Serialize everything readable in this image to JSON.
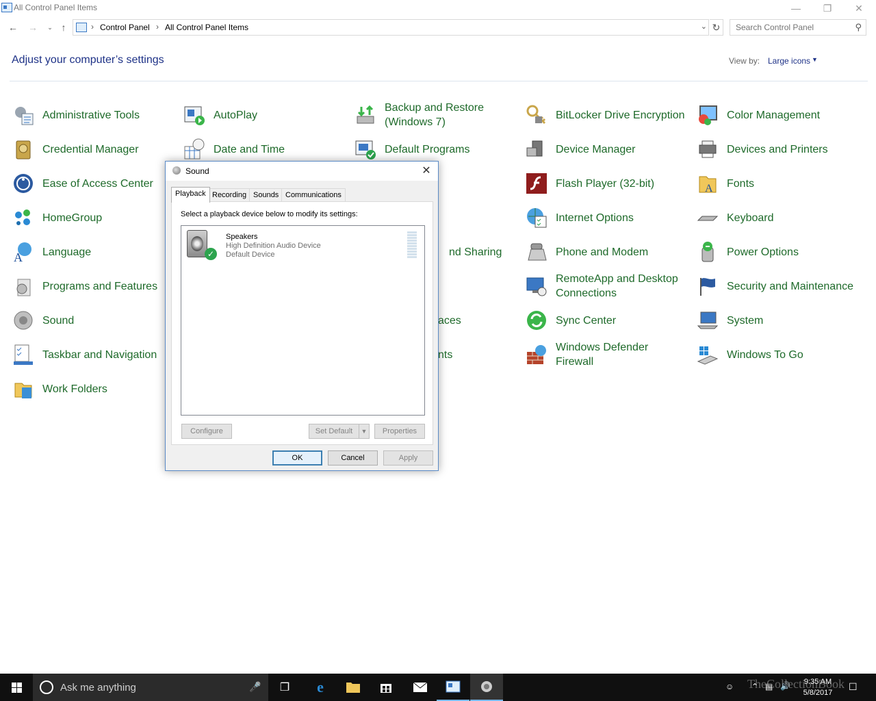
{
  "window": {
    "title": "All Control Panel Items"
  },
  "address": {
    "crumbs": [
      "Control Panel",
      "All Control Panel Items"
    ],
    "search_placeholder": "Search Control Panel"
  },
  "header": {
    "heading": "Adjust your computer’s settings",
    "view_by_label": "View by:",
    "view_by_value": "Large icons"
  },
  "items": [
    {
      "label": "Administrative Tools",
      "icon": "admin-tools-icon"
    },
    {
      "label": "AutoPlay",
      "icon": "autoplay-icon"
    },
    {
      "label": "Backup and Restore (Windows 7)",
      "line1": "Backup and Restore",
      "line2": "(Windows 7)",
      "icon": "backup-icon"
    },
    {
      "label": "BitLocker Drive Encryption",
      "icon": "bitlocker-icon"
    },
    {
      "label": "Color Management",
      "icon": "color-management-icon"
    },
    {
      "label": "Credential Manager",
      "icon": "credential-manager-icon"
    },
    {
      "label": "Date and Time",
      "icon": "date-time-icon"
    },
    {
      "label": "Default Programs",
      "icon": "default-programs-icon"
    },
    {
      "label": "Device Manager",
      "icon": "device-manager-icon"
    },
    {
      "label": "Devices and Printers",
      "icon": "devices-printers-icon"
    },
    {
      "label": "Ease of Access Center",
      "icon": "ease-of-access-icon"
    },
    {
      "label": "Flash Player (32-bit)",
      "icon": "flash-player-icon"
    },
    {
      "label": "Fonts",
      "icon": "fonts-icon"
    },
    {
      "label": "HomeGroup",
      "icon": "homegroup-icon"
    },
    {
      "label": "nd Sharing",
      "icon": ""
    },
    {
      "label": "Internet Options",
      "icon": "internet-options-icon"
    },
    {
      "label": "Keyboard",
      "icon": "keyboard-icon"
    },
    {
      "label": "Language",
      "icon": "language-icon"
    },
    {
      "label": "Phone and Modem",
      "icon": "phone-modem-icon"
    },
    {
      "label": "Power Options",
      "icon": "power-options-icon"
    },
    {
      "label": "Programs and Features",
      "icon": "programs-features-icon"
    },
    {
      "label": "RemoteApp and Desktop Connections",
      "line1": "RemoteApp and Desktop",
      "line2": "Connections",
      "icon": "remoteapp-icon"
    },
    {
      "label": "Security and Maintenance",
      "icon": "security-flag-icon"
    },
    {
      "label": "Sound",
      "icon": "sound-icon"
    },
    {
      "label": "aces",
      "icon": ""
    },
    {
      "label": "Sync Center",
      "icon": "sync-center-icon"
    },
    {
      "label": "System",
      "icon": "system-icon"
    },
    {
      "label": "Taskbar and Navigation",
      "icon": "taskbar-icon"
    },
    {
      "label": "nts",
      "icon": ""
    },
    {
      "label": "Windows Defender Firewall",
      "line1": "Windows Defender",
      "line2": "Firewall",
      "icon": "firewall-icon"
    },
    {
      "label": "Windows To Go",
      "icon": "windows-to-go-icon"
    },
    {
      "label": "Work Folders",
      "icon": "work-folders-icon"
    }
  ],
  "dialog": {
    "title": "Sound",
    "tabs": [
      "Playback",
      "Recording",
      "Sounds",
      "Communications"
    ],
    "active_tab": "Playback",
    "instruction": "Select a playback device below to modify its settings:",
    "device": {
      "name": "Speakers",
      "driver": "High Definition Audio Device",
      "status": "Default Device"
    },
    "buttons": {
      "configure": "Configure",
      "set_default": "Set Default",
      "properties": "Properties",
      "ok": "OK",
      "cancel": "Cancel",
      "apply": "Apply"
    }
  },
  "taskbar": {
    "search_placeholder": "Ask me anything",
    "time": "9:35 AM",
    "date": "5/8/2017",
    "watermark": "TheCollectionBook"
  },
  "colors": {
    "link_green": "#1e6a2a",
    "heading_blue": "#1e3287",
    "dialog_border": "#5a8ac6",
    "taskbar": "#101010"
  }
}
